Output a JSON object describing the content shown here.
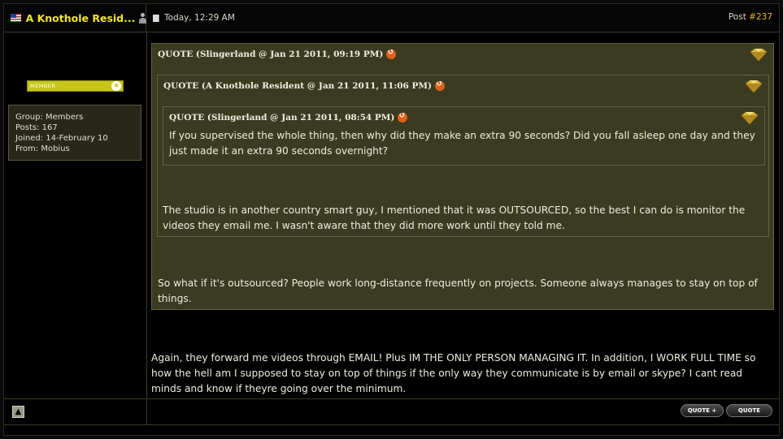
{
  "header": {
    "username": "A Knothole Resid...",
    "date": "Today, 12:29 AM",
    "post_label": "Post ",
    "post_number": "#237"
  },
  "profile": {
    "rank_label": "MEMBER",
    "group": "Group: Members",
    "posts": "Posts: 167",
    "joined": "Joined: 14-February 10",
    "from": "From: Mobius"
  },
  "quotes": {
    "outer": {
      "header": "QUOTE (Slingerland @ Jan 21 2011, 09:19 PM)",
      "reply": "So what if it's outsourced? People work long-distance frequently on projects. Someone always manages to stay on top of things."
    },
    "middle": {
      "header": "QUOTE (A Knothole Resident @ Jan 21 2011, 11:06 PM)",
      "reply": "The studio is in another country smart guy, I mentioned that it was OUTSOURCED, so the best I can do is monitor the videos they email me. I wasn't aware that they did more work until they told me."
    },
    "inner": {
      "header": "QUOTE (Slingerland @ Jan 21 2011, 08:54 PM)",
      "text": "If you supervised the whole thing, then why did they make an extra 90 seconds? Did you fall asleep one day and they just made it an extra 90 seconds overnight?"
    }
  },
  "post_text": "Again, they forward me videos through EMAIL! Plus IM THE ONLY PERSON MANAGING IT. In addition, I WORK FULL TIME so how the hell am I supposed to stay on top of things if the only way they communicate is by email or skype? I cant read minds and know if theyre going over the minimum.",
  "buttons": {
    "multiquote": "QUOTE +",
    "quote": "QUOTE"
  },
  "icons": {
    "flag": "us-flag-icon",
    "profile": "person-icon",
    "date": "document-icon",
    "quote_gem": "gem-icon",
    "jump": "arrow-circle-icon",
    "top": "up-arrow-icon"
  },
  "colors": {
    "username": "#f5e42a",
    "post_number": "#f0b020",
    "quote_bg": "#3b3b22",
    "quote_border": "#62623d",
    "rank_bar": "#c7c51a"
  }
}
